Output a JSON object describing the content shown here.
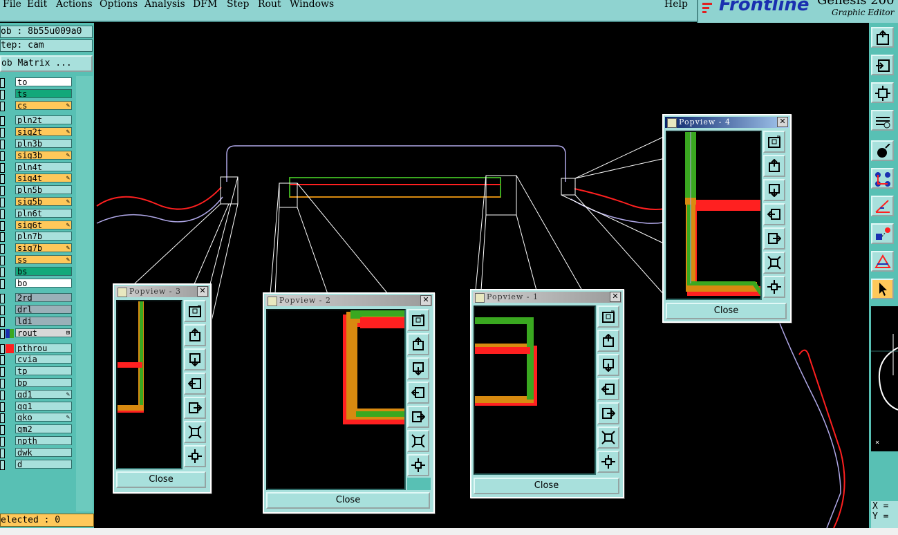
{
  "menubar": {
    "items": [
      "File",
      "Edit",
      "Actions",
      "Options",
      "Analysis",
      "DFM",
      "Step",
      "Rout",
      "Windows"
    ],
    "help": "Help"
  },
  "brand": {
    "logo": "Frontline",
    "product": "Genesis 200",
    "subtitle": "Graphic Editor"
  },
  "left_panel": {
    "job": "ob : 8b55u009a0",
    "step": "tep: cam",
    "matrix_button": "ob Matrix ...",
    "selected": "elected : 0"
  },
  "layers": [
    {
      "name": "to",
      "bg": "#ffffff",
      "mark": ""
    },
    {
      "name": "ts",
      "bg": "#12a87a",
      "mark": ""
    },
    {
      "name": "cs",
      "bg": "#ffc85a",
      "mark": "✎"
    },
    {
      "name": "pln2t",
      "bg": "#a8e0dc",
      "mark": ""
    },
    {
      "name": "sig2t",
      "bg": "#ffc85a",
      "mark": "✎"
    },
    {
      "name": "pln3b",
      "bg": "#a8e0dc",
      "mark": ""
    },
    {
      "name": "sig3b",
      "bg": "#ffc85a",
      "mark": "✎"
    },
    {
      "name": "pln4t",
      "bg": "#a8e0dc",
      "mark": ""
    },
    {
      "name": "sig4t",
      "bg": "#ffc85a",
      "mark": "✎"
    },
    {
      "name": "pln5b",
      "bg": "#a8e0dc",
      "mark": ""
    },
    {
      "name": "sig5b",
      "bg": "#ffc85a",
      "mark": "✎"
    },
    {
      "name": "pln6t",
      "bg": "#a8e0dc",
      "mark": ""
    },
    {
      "name": "sig6t",
      "bg": "#ffc85a",
      "mark": "✎"
    },
    {
      "name": "pln7b",
      "bg": "#a8e0dc",
      "mark": ""
    },
    {
      "name": "sig7b",
      "bg": "#ffc85a",
      "mark": "✎"
    },
    {
      "name": "ss",
      "bg": "#ffc85a",
      "mark": "✎"
    },
    {
      "name": "bs",
      "bg": "#12a87a",
      "mark": ""
    },
    {
      "name": "bo",
      "bg": "#ffffff",
      "mark": ""
    },
    {
      "name": "2rd",
      "bg": "#9ab0b8",
      "mark": ""
    },
    {
      "name": "drl",
      "bg": "#9ab0b8",
      "mark": ""
    },
    {
      "name": "ldi",
      "bg": "#9ab0b8",
      "mark": ""
    },
    {
      "name": "rout",
      "bg": "#d8d8d8",
      "mark": "⊞",
      "color_left": "#1a2fb0",
      "color_right": "#3aa820"
    },
    {
      "name": "pthrou",
      "bg": "#a8e0dc",
      "mark": "",
      "color": "#ff2020"
    },
    {
      "name": "cvia",
      "bg": "#a8e0dc",
      "mark": ""
    },
    {
      "name": "tp",
      "bg": "#a8e0dc",
      "mark": ""
    },
    {
      "name": "bp",
      "bg": "#a8e0dc",
      "mark": ""
    },
    {
      "name": "gd1",
      "bg": "#a8e0dc",
      "mark": "✎"
    },
    {
      "name": "gg1",
      "bg": "#a8e0dc",
      "mark": ""
    },
    {
      "name": "gko",
      "bg": "#a8e0dc",
      "mark": "✎"
    },
    {
      "name": "gm2",
      "bg": "#a8e0dc",
      "mark": ""
    },
    {
      "name": "npth",
      "bg": "#a8e0dc",
      "mark": ""
    },
    {
      "name": "dwk",
      "bg": "#a8e0dc",
      "mark": ""
    },
    {
      "name": "d",
      "bg": "#a8e0dc",
      "mark": ""
    }
  ],
  "popviews": [
    {
      "title": "Popview - 3",
      "close": "Close",
      "active": false
    },
    {
      "title": "Popview - 2",
      "close": "Close",
      "active": false
    },
    {
      "title": "Popview - 1",
      "close": "Close",
      "active": false
    },
    {
      "title": "Popview - 4",
      "close": "Close",
      "active": true
    }
  ],
  "readout": {
    "x": "X =",
    "y": "Y ="
  },
  "preview_mark": "×",
  "colors": {
    "panel": "#58c0b4",
    "field": "#a8e0dc",
    "menubar": "#8fd3d0",
    "trace_red": "#ff2020",
    "trace_green": "#3aa820",
    "trace_orange": "#d88a10",
    "outline": "#b0a8e8"
  }
}
